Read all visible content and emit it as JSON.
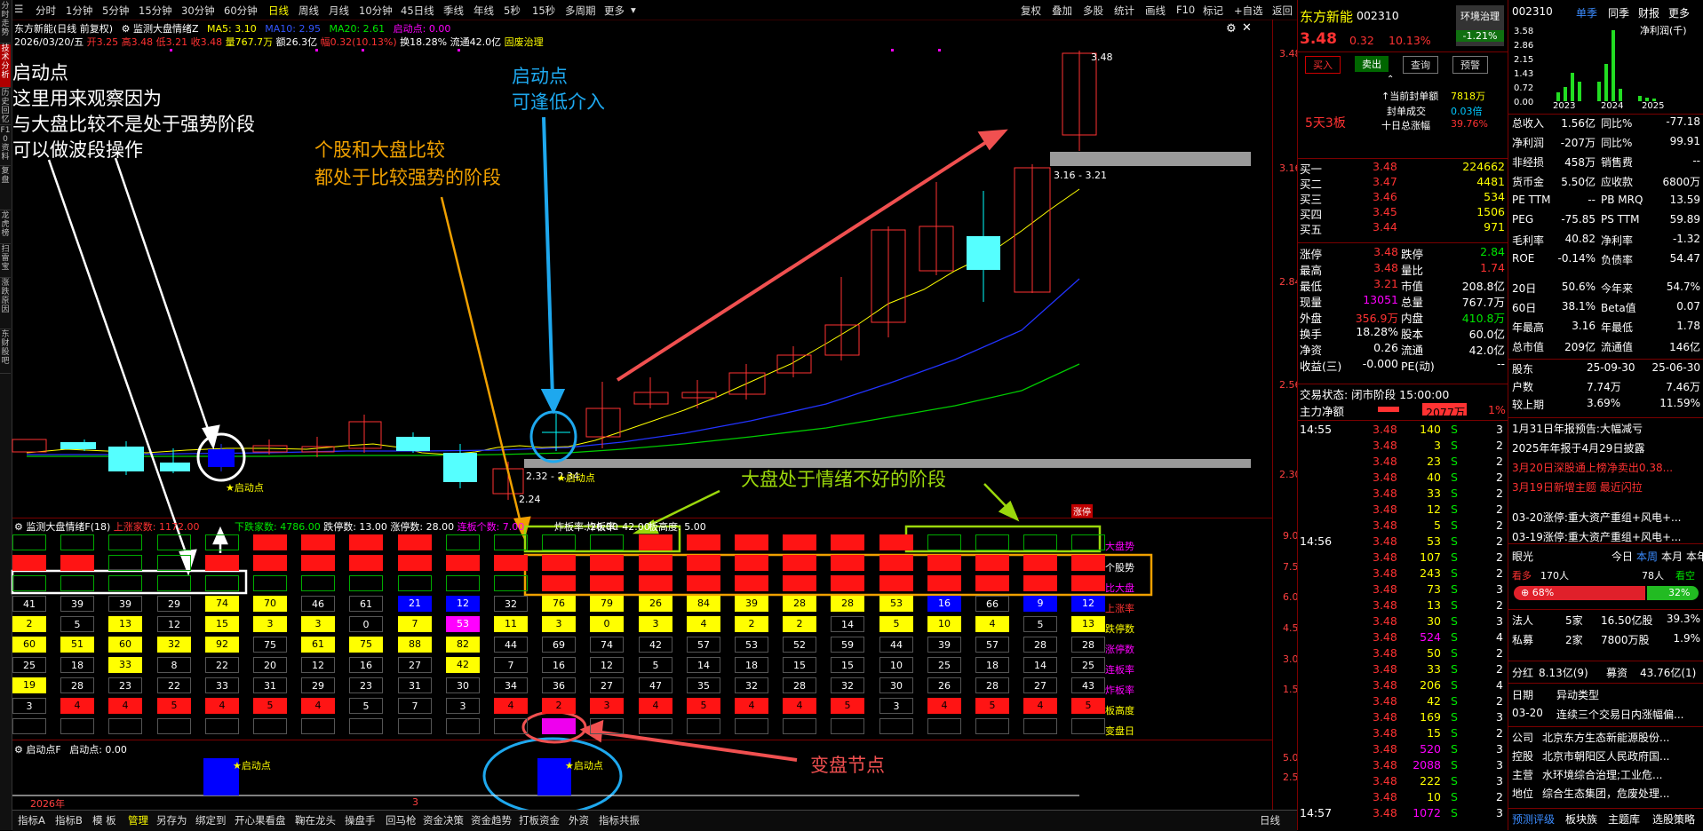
{
  "left_tabs": [
    "分时走势",
    "技术分析",
    "历史回忆",
    "F10资料",
    "复盘",
    "龙虎榜",
    "扫雷宝",
    "涨跌原因",
    "东财股吧"
  ],
  "toolbar": {
    "items": [
      "分时",
      "1分钟",
      "5分钟",
      "15分钟",
      "30分钟",
      "60分钟",
      "日线",
      "周线",
      "月线",
      "10分钟",
      "45日线",
      "季线",
      "年线",
      "5秒",
      "15秒",
      "多周期",
      "更多"
    ],
    "selected": "日线",
    "right_items": [
      "复权",
      "叠加",
      "多股",
      "统计",
      "画线",
      "F10",
      "标记",
      "+自选",
      "返回"
    ]
  },
  "chart": {
    "title": "东方新能(日线 前复权)",
    "indicator_title": "监测大盘情绪Z",
    "ma5": "MA5: 3.10",
    "ma10": "MA10: 2.95",
    "ma20": "MA20: 2.61",
    "qidong": "启动点: 0.00",
    "date": "2026/03/20/五",
    "ohlc_open": "开3.25",
    "ohlc_high": "高3.48",
    "ohlc_low": "低3.21",
    "ohlc_close": "收3.48",
    "vol": "量767.7万",
    "amount": "额26.3亿",
    "change": "幅0.32(10.13%)",
    "turnover": "换18.28%",
    "float": "流通42.0亿",
    "concept": "固废治理",
    "price_axis": [
      "3.48",
      "3.16",
      "2.84",
      "2.56",
      "2.30"
    ],
    "peak_label": "3.48",
    "range_label": "3.16 - 3.21",
    "low_label": "2.24",
    "low_range_label": "2.32 - 2.34",
    "qidong_label": "启动点",
    "ann1_line1": "启动点",
    "ann1_line2": "这里用来观察因为",
    "ann1_line3": "与大盘比较不是处于强势阶段",
    "ann1_line4": "可以做波段操作",
    "ann2_line1": "启动点",
    "ann2_line2": "可逢低介入",
    "ann3_line1": "个股和大盘比较",
    "ann3_line2": "都处于比较强势的阶段",
    "ann4": "大盘处于情绪不好的阶段",
    "ann5": "变盘节点"
  },
  "sub1": {
    "title": "监测大盘情绪F(18)",
    "stat_up": "上涨家数: 1172.00",
    "stat_down": "下跌家数: 4786.00",
    "stat_dieting": "跌停数: 13.00",
    "stat_zhangting": "涨停数: 28.00",
    "stat_lianban": "连板个数: 7.00",
    "stat_zhaban": "炸板率: 26.00",
    "stat_zhaban2": "炸板率: 42.00",
    "stat_banh": "板高度: 5.00",
    "axis": [
      "9.00",
      "7.50",
      "6.00",
      "4.50",
      "3.00",
      "1.50"
    ],
    "zhangting_tag": "涨停",
    "row_labels": [
      "大盘势",
      "个股势",
      "比大盘",
      "上涨率",
      "跌停数",
      "涨停数",
      "连板率",
      "炸板率",
      "板高度",
      "变盘日"
    ],
    "rows": {
      "r4": [
        "41",
        "39",
        "39",
        "29",
        "74",
        "70",
        "46",
        "61",
        "21",
        "12",
        "32",
        "76",
        "79",
        "26",
        "84",
        "39",
        "28",
        "28",
        "53",
        "16",
        "66",
        "9",
        "12"
      ],
      "r5": [
        "2",
        "5",
        "13",
        "12",
        "15",
        "3",
        "3",
        "0",
        "7",
        "53",
        "11",
        "3",
        "0",
        "3",
        "4",
        "2",
        "2",
        "14",
        "5",
        "10",
        "4",
        "5",
        "13"
      ],
      "r6": [
        "60",
        "51",
        "60",
        "32",
        "92",
        "75",
        "61",
        "75",
        "88",
        "82",
        "44",
        "69",
        "74",
        "42",
        "57",
        "53",
        "52",
        "59",
        "44",
        "39",
        "57",
        "28",
        "28"
      ],
      "r7": [
        "25",
        "18",
        "33",
        "8",
        "22",
        "20",
        "12",
        "16",
        "27",
        "42",
        "7",
        "16",
        "12",
        "5",
        "14",
        "18",
        "15",
        "15",
        "10",
        "25",
        "18",
        "14",
        "25"
      ],
      "r8": [
        "19",
        "28",
        "23",
        "22",
        "33",
        "31",
        "29",
        "23",
        "31",
        "30",
        "34",
        "36",
        "27",
        "47",
        "35",
        "32",
        "28",
        "32",
        "30",
        "26",
        "28",
        "27",
        "43"
      ],
      "r9": [
        "3",
        "4",
        "4",
        "5",
        "4",
        "5",
        "4",
        "5",
        "7",
        "3",
        "4",
        "2",
        "3",
        "4",
        "5",
        "4",
        "4",
        "5",
        "3",
        "4",
        "5",
        "4",
        "5"
      ]
    }
  },
  "sub2": {
    "title": "启动点F",
    "value": "启动点: 0.00",
    "axis": [
      "5.00",
      "2.50"
    ],
    "label": "启动点"
  },
  "timeaxis": [
    "2026年",
    "3"
  ],
  "bottom_tabs": [
    "指标A",
    "指标B",
    "模 板",
    "管理",
    "另存为",
    "绑定到",
    "开心果看盘",
    "鞠在龙头",
    "操盘手",
    "回马枪",
    "资金决策",
    "资金趋势",
    "打板资金",
    "外资",
    "指标共振"
  ],
  "bottom_right": "日线",
  "quote": {
    "name": "东方新能",
    "code": "002310",
    "tag": "环境治理",
    "tag_pct": "-1.21%",
    "price": "3.48",
    "chg": "0.32",
    "pct": "10.13%",
    "btn_buy": "买入",
    "btn_sell": "卖出",
    "btn_query": "查询",
    "btn_warn": "预警",
    "board": "5天3板",
    "seal_vol_label": "当前封单额",
    "seal_vol": "7818万",
    "seal_deal_label": "封单成交",
    "seal_deal": "0.03倍",
    "ten_day_label": "十日总涨幅",
    "ten_day": "39.76%",
    "bids": [
      {
        "l": "买一",
        "p": "3.48",
        "v": "224662"
      },
      {
        "l": "买二",
        "p": "3.47",
        "v": "4481"
      },
      {
        "l": "买三",
        "p": "3.46",
        "v": "534"
      },
      {
        "l": "买四",
        "p": "3.45",
        "v": "1506"
      },
      {
        "l": "买五",
        "p": "3.44",
        "v": "971"
      }
    ],
    "stats": [
      {
        "a": "涨停",
        "av": "3.48",
        "b": "跌停",
        "bv": "2.84"
      },
      {
        "a": "最高",
        "av": "3.48",
        "b": "量比",
        "bv": "1.74"
      },
      {
        "a": "最低",
        "av": "3.21",
        "b": "市值",
        "bv": "208.8亿"
      },
      {
        "a": "现量",
        "av": "13051",
        "b": "总量",
        "bv": "767.7万"
      },
      {
        "a": "外盘",
        "av": "356.9万",
        "b": "内盘",
        "bv": "410.8万"
      },
      {
        "a": "换手",
        "av": "18.28%",
        "b": "股本",
        "bv": "60.0亿"
      },
      {
        "a": "净资",
        "av": "0.26",
        "b": "流通",
        "bv": "42.0亿"
      },
      {
        "a": "收益(三)",
        "av": "-0.000",
        "b": "PE(动)",
        "bv": "--"
      }
    ],
    "trade_status": "交易状态: 闭市阶段 15:00:00",
    "main_flow_label": "主力净额",
    "main_flow": "2077万",
    "main_flow_pct": "1%",
    "ticks": [
      {
        "t": "14:55",
        "p": "3.48",
        "v": "140",
        "s": "S",
        "n": "3"
      },
      {
        "t": "",
        "p": "3.48",
        "v": "3",
        "s": "S",
        "n": "2"
      },
      {
        "t": "",
        "p": "3.48",
        "v": "23",
        "s": "S",
        "n": "2"
      },
      {
        "t": "",
        "p": "3.48",
        "v": "40",
        "s": "S",
        "n": "2"
      },
      {
        "t": "",
        "p": "3.48",
        "v": "33",
        "s": "S",
        "n": "2"
      },
      {
        "t": "",
        "p": "3.48",
        "v": "12",
        "s": "S",
        "n": "2"
      },
      {
        "t": "",
        "p": "3.48",
        "v": "5",
        "s": "S",
        "n": "2"
      },
      {
        "t": "14:56",
        "p": "3.48",
        "v": "53",
        "s": "S",
        "n": "2"
      },
      {
        "t": "",
        "p": "3.48",
        "v": "107",
        "s": "S",
        "n": "2"
      },
      {
        "t": "",
        "p": "3.48",
        "v": "243",
        "s": "S",
        "n": "2"
      },
      {
        "t": "",
        "p": "3.48",
        "v": "73",
        "s": "S",
        "n": "3"
      },
      {
        "t": "",
        "p": "3.48",
        "v": "13",
        "s": "S",
        "n": "2"
      },
      {
        "t": "",
        "p": "3.48",
        "v": "30",
        "s": "S",
        "n": "3"
      },
      {
        "t": "",
        "p": "3.48",
        "v": "524",
        "s": "S",
        "n": "4"
      },
      {
        "t": "",
        "p": "3.48",
        "v": "50",
        "s": "S",
        "n": "2"
      },
      {
        "t": "",
        "p": "3.48",
        "v": "33",
        "s": "S",
        "n": "2"
      },
      {
        "t": "",
        "p": "3.48",
        "v": "206",
        "s": "S",
        "n": "4"
      },
      {
        "t": "",
        "p": "3.48",
        "v": "42",
        "s": "S",
        "n": "2"
      },
      {
        "t": "",
        "p": "3.48",
        "v": "169",
        "s": "S",
        "n": "3"
      },
      {
        "t": "",
        "p": "3.48",
        "v": "15",
        "s": "S",
        "n": "2"
      },
      {
        "t": "",
        "p": "3.48",
        "v": "520",
        "s": "S",
        "n": "3"
      },
      {
        "t": "",
        "p": "3.48",
        "v": "2088",
        "s": "S",
        "n": "3"
      },
      {
        "t": "",
        "p": "3.48",
        "v": "222",
        "s": "S",
        "n": "3"
      },
      {
        "t": "",
        "p": "3.48",
        "v": "10",
        "s": "S",
        "n": "2"
      },
      {
        "t": "14:57",
        "p": "3.48",
        "v": "1072",
        "s": "S",
        "n": "3"
      }
    ]
  },
  "fund": {
    "code": "002310",
    "tabs": [
      "单季",
      "同季",
      "财报",
      "更多"
    ],
    "chart_title": "净利润(千)",
    "y_axis": [
      "3.58",
      "2.86",
      "2.15",
      "1.43",
      "0.72",
      "0.00"
    ],
    "x_axis": [
      "2023",
      "2024",
      "2025"
    ],
    "rows": [
      {
        "a": "总收入",
        "av": "1.56亿",
        "b": "同比%",
        "bv": "-77.18"
      },
      {
        "a": "净利润",
        "av": "-207万",
        "b": "同比%",
        "bv": "99.91"
      },
      {
        "a": "非经损",
        "av": "458万",
        "b": "销售费",
        "bv": "--"
      },
      {
        "a": "货币金",
        "av": "5.50亿",
        "b": "应收款",
        "bv": "6800万"
      },
      {
        "a": "PE TTM",
        "av": "--",
        "b": "PB MRQ",
        "bv": "13.59"
      },
      {
        "a": "PEG",
        "av": "-75.85",
        "b": "PS TTM",
        "bv": "59.89"
      },
      {
        "a": "毛利率",
        "av": "40.82",
        "b": "净利率",
        "bv": "-1.32"
      },
      {
        "a": "ROE",
        "av": "-0.14%",
        "b": "负债率",
        "bv": "54.47"
      },
      {
        "a": "20日",
        "av": "50.6%",
        "b": "今年来",
        "bv": "54.7%"
      },
      {
        "a": "60日",
        "av": "38.1%",
        "b": "Beta值",
        "bv": "0.07"
      },
      {
        "a": "年最高",
        "av": "3.16",
        "b": "年最低",
        "bv": "1.78"
      },
      {
        "a": "总市值",
        "av": "209亿",
        "b": "流通值",
        "bv": "146亿"
      }
    ],
    "holder_rows": [
      {
        "a": "股东",
        "av": "25-09-30",
        "bv": "25-06-30"
      },
      {
        "a": "户数",
        "av": "7.74万",
        "bv": "7.46万"
      },
      {
        "a": "较上期",
        "av": "3.69%",
        "bv": "11.59%"
      }
    ],
    "news": [
      {
        "t": "1月31日年报预告:大幅减亏",
        "c": "white"
      },
      {
        "t": "2025年年报于4月29日披露",
        "c": "white"
      },
      {
        "t": "3月20日深股通上榜净卖出0.38...",
        "c": "red"
      },
      {
        "t": "3月19日新增主题 最近闪拉",
        "c": "red"
      },
      {
        "t": "03-20涨停:重大资产重组+风电+...",
        "c": "white"
      },
      {
        "t": "03-19涨停:重大资产重组+风电+...",
        "c": "white"
      }
    ],
    "eyes_label": "眼光",
    "eyes_tabs": [
      "今日",
      "本周",
      "本月",
      "本年"
    ],
    "bull_label": "看多",
    "bull_count": "170人",
    "bear_count": "78人",
    "bear_label": "看空",
    "bull_pct": "68%",
    "bear_pct": "32%",
    "inst": [
      {
        "a": "法人",
        "av": "5家",
        "bv": "16.50亿股",
        "cv": "39.3%"
      },
      {
        "a": "私募",
        "av": "2家",
        "bv": "7800万股",
        "cv": "1.9%"
      }
    ],
    "dividend": {
      "a": "分红",
      "av": "8.13亿(9)",
      "b": "募资",
      "bv": "43.76亿(1)"
    },
    "anomaly_h1": "日期",
    "anomaly_h2": "异动类型",
    "anomaly": {
      "d": "03-20",
      "t": "连续三个交易日内涨幅偏..."
    },
    "company": [
      {
        "a": "公司",
        "v": "北京东方生态新能源股份..."
      },
      {
        "a": "控股",
        "v": "北京市朝阳区人民政府国..."
      },
      {
        "a": "主营",
        "v": "水环境综合治理;工业危..."
      },
      {
        "a": "地位",
        "v": "综合生态集团，危废处理..."
      }
    ],
    "bottom": [
      "预测评级",
      "板块族",
      "主题库",
      "选股策略"
    ]
  }
}
